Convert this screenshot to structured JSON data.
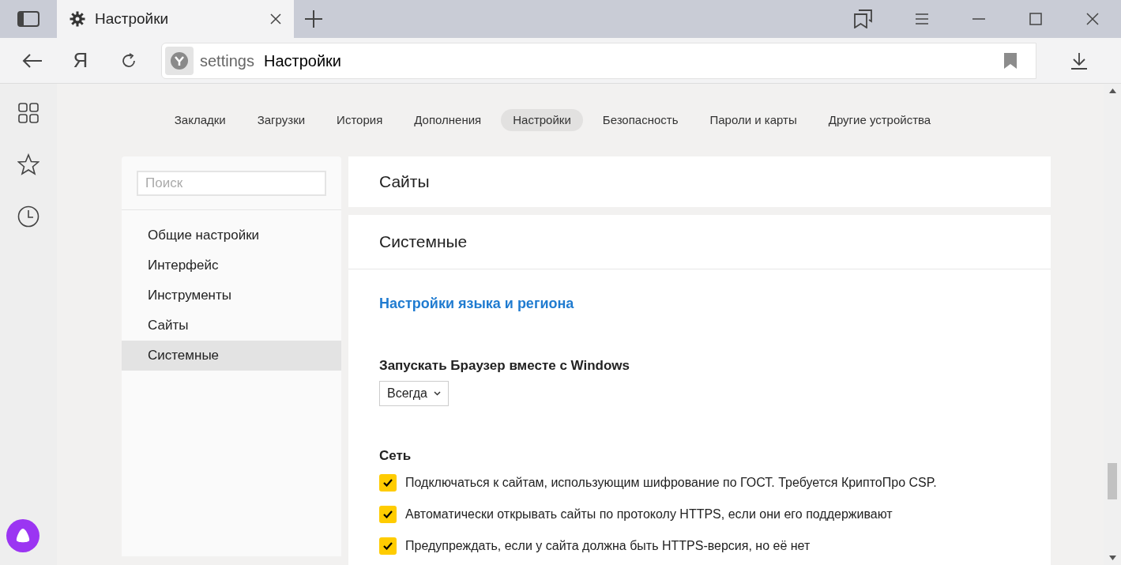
{
  "browser_tab": {
    "title": "Настройки",
    "selected": true
  },
  "toolbar": {
    "yandex_button": "Я",
    "address": {
      "scheme": "settings",
      "title": "Настройки"
    }
  },
  "nav_tabs": [
    {
      "label": "Закладки",
      "selected": false
    },
    {
      "label": "Загрузки",
      "selected": false
    },
    {
      "label": "История",
      "selected": false
    },
    {
      "label": "Дополнения",
      "selected": false
    },
    {
      "label": "Настройки",
      "selected": true
    },
    {
      "label": "Безопасность",
      "selected": false
    },
    {
      "label": "Пароли и карты",
      "selected": false
    },
    {
      "label": "Другие устройства",
      "selected": false
    }
  ],
  "sidebar": {
    "search": {
      "placeholder": "Поиск"
    },
    "items": [
      {
        "label": "Общие настройки",
        "selected": false
      },
      {
        "label": "Интерфейс",
        "selected": false
      },
      {
        "label": "Инструменты",
        "selected": false
      },
      {
        "label": "Сайты",
        "selected": false
      },
      {
        "label": "Системные",
        "selected": true
      }
    ]
  },
  "sites_card": {
    "title": "Сайты"
  },
  "system_card": {
    "title": "Системные",
    "link": "Настройки языка и региона",
    "autostart": {
      "label": "Запускать Браузер вместе с Windows",
      "value": "Всегда"
    },
    "network": {
      "heading": "Сеть",
      "options": [
        {
          "label": "Подключаться к сайтам, использующим шифрование по ГОСТ. Требуется КриптоПро CSP.",
          "checked": true
        },
        {
          "label": "Автоматически открывать сайты по протоколу HTTPS, если они его поддерживают",
          "checked": true
        },
        {
          "label": "Предупреждать, если у сайта должна быть HTTPS-версия, но её нет",
          "checked": true
        }
      ]
    }
  }
}
